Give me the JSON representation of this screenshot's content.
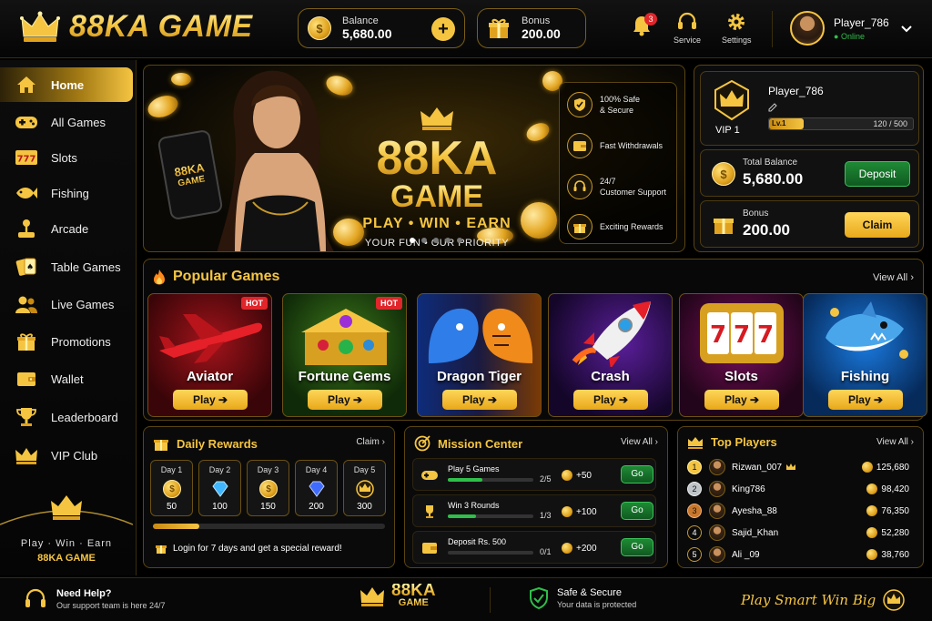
{
  "header": {
    "logo_text": "88KA GAME",
    "balance_label": "Balance",
    "balance_value": "5,680.00",
    "bonus_label": "Bonus",
    "bonus_value": "200.00",
    "notifications_count": "3",
    "service_label": "Service",
    "settings_label": "Settings",
    "username": "Player_786",
    "status": "Online"
  },
  "sidebar": {
    "items": [
      {
        "label": "Home"
      },
      {
        "label": "All Games"
      },
      {
        "label": "Slots"
      },
      {
        "label": "Fishing"
      },
      {
        "label": "Arcade"
      },
      {
        "label": "Table Games"
      },
      {
        "label": "Live Games"
      },
      {
        "label": "Promotions"
      },
      {
        "label": "Wallet"
      },
      {
        "label": "Leaderboard"
      },
      {
        "label": "VIP Club"
      }
    ],
    "tagline": "Play · Win · Earn",
    "brand": "88KA GAME"
  },
  "banner": {
    "title_line1": "88KA",
    "title_line2": "GAME",
    "slogan": "PLAY  •  WIN  •  EARN",
    "subslogan": "YOUR FUN  •  OUR PRIORITY",
    "phone_text_1": "88KA",
    "phone_text_2": "GAME",
    "features": [
      {
        "line1": "100% Safe",
        "line2": "& Secure"
      },
      {
        "line1": "Fast Withdrawals",
        "line2": ""
      },
      {
        "line1": "24/7",
        "line2": "Customer Support"
      },
      {
        "line1": "Exciting Rewards",
        "line2": ""
      }
    ]
  },
  "vip": {
    "username": "Player_786",
    "level": "VIP 1",
    "level_badge": "Lv.1",
    "xp_text": "120 / 500",
    "xp_fraction": 0.24,
    "total_balance_label": "Total Balance",
    "total_balance_value": "5,680.00",
    "deposit_label": "Deposit",
    "bonus_label": "Bonus",
    "bonus_value": "200.00",
    "claim_label": "Claim"
  },
  "popular": {
    "title": "Popular Games",
    "view_all": "View All",
    "games": [
      {
        "name": "Aviator",
        "play": "Play ➔",
        "hot": "HOT"
      },
      {
        "name": "Fortune Gems",
        "play": "Play ➔",
        "hot": "HOT"
      },
      {
        "name": "Dragon Tiger",
        "play": "Play ➔",
        "hot": ""
      },
      {
        "name": "Crash",
        "play": "Play ➔",
        "hot": ""
      },
      {
        "name": "Slots",
        "play": "Play ➔",
        "hot": ""
      },
      {
        "name": "Fishing",
        "play": "Play ➔",
        "hot": ""
      }
    ]
  },
  "daily": {
    "title": "Daily Rewards",
    "claim": "Claim",
    "days": [
      {
        "label": "Day 1",
        "value": "50"
      },
      {
        "label": "Day 2",
        "value": "100"
      },
      {
        "label": "Day 3",
        "value": "150"
      },
      {
        "label": "Day 4",
        "value": "200"
      },
      {
        "label": "Day 5",
        "value": "300"
      }
    ],
    "progress_fraction": 0.2,
    "note": "Login for 7 days and get a special reward!"
  },
  "missions": {
    "title": "Mission Center",
    "view_all": "View All",
    "items": [
      {
        "name": "Play 5 Games",
        "progress": "2/5",
        "fraction": 0.4,
        "reward": "+50",
        "go": "Go"
      },
      {
        "name": "Win 3 Rounds",
        "progress": "1/3",
        "fraction": 0.33,
        "reward": "+100",
        "go": "Go"
      },
      {
        "name": "Deposit Rs. 500",
        "progress": "0/1",
        "fraction": 0.0,
        "reward": "+200",
        "go": "Go"
      }
    ]
  },
  "top_players": {
    "title": "Top Players",
    "view_all": "View All",
    "players": [
      {
        "rank": "1",
        "name": "Rizwan_007",
        "score": "125,680"
      },
      {
        "rank": "2",
        "name": "King786",
        "score": "98,420"
      },
      {
        "rank": "3",
        "name": "Ayesha_88",
        "score": "76,350"
      },
      {
        "rank": "4",
        "name": "Sajid_Khan",
        "score": "52,280"
      },
      {
        "rank": "5",
        "name": "Ali _09",
        "score": "38,760"
      }
    ]
  },
  "footer": {
    "help_title": "Need Help?",
    "help_sub": "Our support team is here 24/7",
    "brand_line1": "88KA",
    "brand_line2": "GAME",
    "safe_title": "Safe & Secure",
    "safe_sub": "Your data is protected",
    "slogan": "Play Smart  Win Big"
  },
  "colors": {
    "accent": "#f5c542",
    "green": "#2fbf4a",
    "hot": "#e0262b"
  }
}
